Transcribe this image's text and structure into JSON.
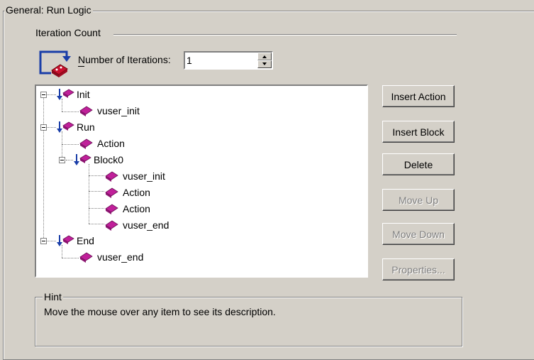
{
  "run_logic": {
    "group_title": "General: Run Logic",
    "iteration": {
      "section_title": "Iteration Count",
      "label": "Number of Iterations:",
      "value": "1"
    },
    "tree": [
      {
        "label": "Init",
        "type": "section",
        "expanded": true
      },
      {
        "label": "vuser_init",
        "type": "action"
      },
      {
        "label": "Run",
        "type": "section",
        "expanded": true
      },
      {
        "label": "Action",
        "type": "action"
      },
      {
        "label": "Block0",
        "type": "block",
        "expanded": true
      },
      {
        "label": "vuser_init",
        "type": "action"
      },
      {
        "label": "Action",
        "type": "action"
      },
      {
        "label": "Action",
        "type": "action"
      },
      {
        "label": "vuser_end",
        "type": "action"
      },
      {
        "label": "End",
        "type": "section",
        "expanded": true
      },
      {
        "label": "vuser_end",
        "type": "action"
      }
    ],
    "buttons": {
      "insert_action": "Insert Action",
      "insert_block": "Insert Block",
      "delete": "Delete",
      "move_up": "Move Up",
      "move_down": "Move Down",
      "properties": "Properties..."
    },
    "hint": {
      "title": "Hint",
      "text": "Move the mouse over any item to see its description."
    }
  },
  "colors": {
    "dialog_bg": "#d4d0c8",
    "icon_blue": "#1a3ea8",
    "icon_red": "#c8102e",
    "icon_magenta": "#c0209a",
    "disabled_text": "#808080"
  },
  "icons": {
    "iterations": "iteration-loop-icon",
    "tree_item": "action-puzzle-icon",
    "tree_section": "section-arrow-icon"
  }
}
